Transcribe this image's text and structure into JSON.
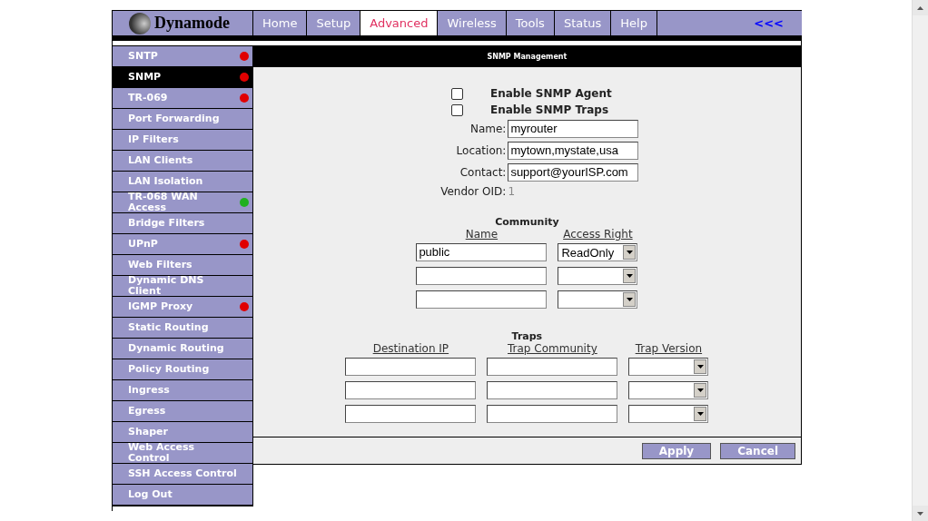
{
  "logo": {
    "text": "Dynamode"
  },
  "nav": [
    {
      "label": "Home",
      "selected": false
    },
    {
      "label": "Setup",
      "selected": false
    },
    {
      "label": "Advanced",
      "selected": true
    },
    {
      "label": "Wireless",
      "selected": false
    },
    {
      "label": "Tools",
      "selected": false
    },
    {
      "label": "Status",
      "selected": false
    },
    {
      "label": "Help",
      "selected": false
    }
  ],
  "nav_back": "<<<",
  "sidebar": {
    "items": [
      {
        "label": "SNTP",
        "selected": false,
        "color": "#e00000"
      },
      {
        "label": "SNMP",
        "selected": true,
        "color": "#e00000"
      },
      {
        "label": "TR-069",
        "selected": false,
        "color": "#e00000"
      },
      {
        "label": "Port Forwarding",
        "selected": false
      },
      {
        "label": "IP Filters",
        "selected": false
      },
      {
        "label": "LAN Clients",
        "selected": false
      },
      {
        "label": "LAN Isolation",
        "selected": false
      },
      {
        "label": "TR-068 WAN Access",
        "selected": false,
        "color": "#20b020"
      },
      {
        "label": "Bridge Filters",
        "selected": false
      },
      {
        "label": "UPnP",
        "selected": false,
        "color": "#e00000"
      },
      {
        "label": "Web Filters",
        "selected": false
      },
      {
        "label": "Dynamic DNS Client",
        "selected": false
      },
      {
        "label": "IGMP Proxy",
        "selected": false,
        "color": "#e00000"
      },
      {
        "label": "Static Routing",
        "selected": false
      },
      {
        "label": "Dynamic Routing",
        "selected": false
      },
      {
        "label": "Policy Routing",
        "selected": false
      },
      {
        "label": "Ingress",
        "selected": false
      },
      {
        "label": "Egress",
        "selected": false
      },
      {
        "label": "Shaper",
        "selected": false
      },
      {
        "label": "Web Access Control",
        "selected": false
      },
      {
        "label": "SSH Access Control",
        "selected": false
      },
      {
        "label": "Log Out",
        "selected": false
      }
    ]
  },
  "panel_title": "SNMP Management",
  "checkboxes": [
    {
      "label": "Enable SNMP Agent",
      "checked": false
    },
    {
      "label": "Enable SNMP Traps",
      "checked": false
    }
  ],
  "fields": [
    {
      "label": "Name:",
      "value": "myrouter"
    },
    {
      "label": "Location:",
      "value": "mytown,mystate,usa"
    },
    {
      "label": "Contact:",
      "value": "support@yourISP.com"
    }
  ],
  "vendor_oid": {
    "label": "Vendor OID:",
    "value": "1"
  },
  "community": {
    "title": "Community",
    "columns": [
      "Name",
      "Access Right"
    ],
    "rows": [
      {
        "name": "public",
        "access": "ReadOnly"
      },
      {},
      {}
    ]
  },
  "traps": {
    "title": "Traps",
    "columns": [
      "Destination IP",
      "Trap Community",
      "Trap Version"
    ],
    "rows": [
      {},
      {},
      {}
    ]
  },
  "buttons": [
    "Apply",
    "Cancel"
  ]
}
